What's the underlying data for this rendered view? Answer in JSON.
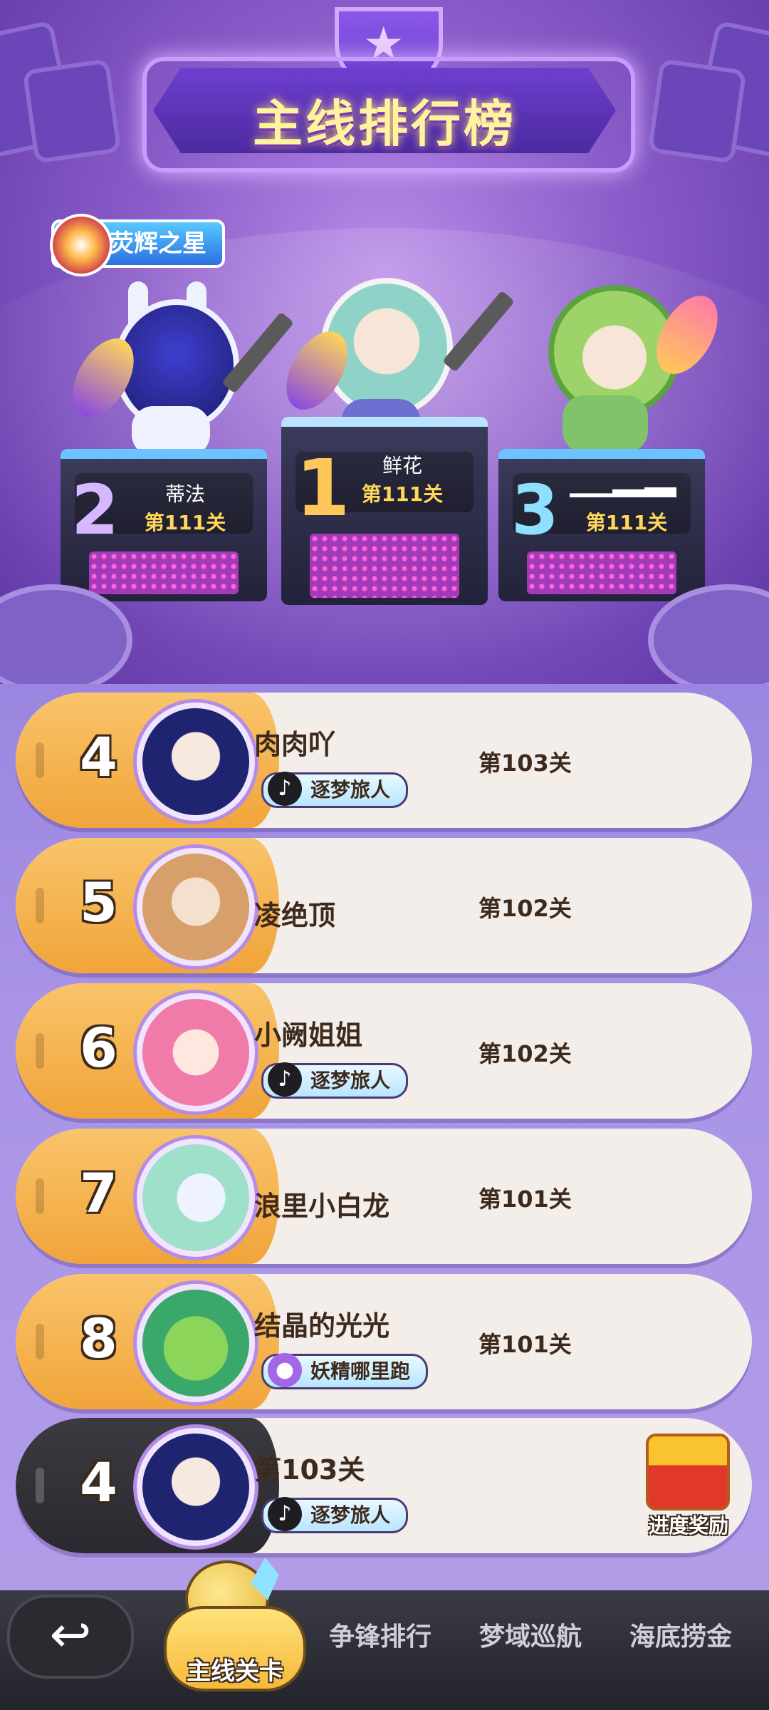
{
  "header": {
    "title": "主线排行榜"
  },
  "badge": {
    "label": "荧辉之星"
  },
  "podium": [
    {
      "rank": "2",
      "name": "蒂法",
      "level": "第111关"
    },
    {
      "rank": "1",
      "name": "鲜花",
      "level": "第111关"
    },
    {
      "rank": "3",
      "name": "",
      "level": "第111关"
    }
  ],
  "list": [
    {
      "rank": "4",
      "name": "肉肉吖",
      "level": "第103关",
      "tag": "逐梦旅人"
    },
    {
      "rank": "5",
      "name": "凌绝顶",
      "level": "第102关"
    },
    {
      "rank": "6",
      "name": "小阙姐姐",
      "level": "第102关",
      "tag": "逐梦旅人"
    },
    {
      "rank": "7",
      "name": "浪里小白龙",
      "level": "第101关"
    },
    {
      "rank": "8",
      "name": "结晶的光光",
      "level": "第101关",
      "tag": "妖精哪里跑"
    }
  ],
  "me": {
    "rank": "4",
    "level": "第103关",
    "tag": "逐梦旅人",
    "reward_label": "进度奖励"
  },
  "nav": {
    "back_icon": "back-arrow-icon",
    "tabs": [
      "主线关卡",
      "争锋排行",
      "梦域巡航",
      "海底捞金"
    ],
    "active": "主线关卡"
  },
  "colors": {
    "accent": "#f1a43a",
    "bg": "#8e6ad6"
  }
}
